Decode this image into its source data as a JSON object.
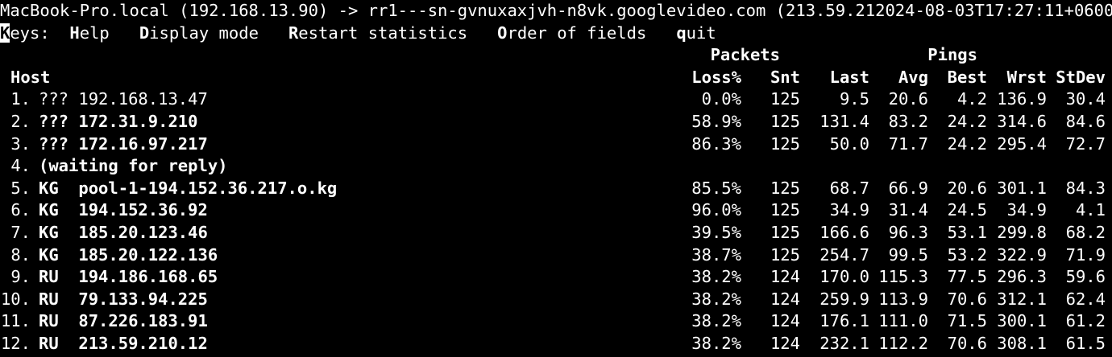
{
  "title_line": "MacBook-Pro.local (192.168.13.90) -> rr1---sn-gvnuxaxjvh-n8vk.googlevideo.com (213.59.212024-08-03T17:27:11+0600",
  "keys": {
    "label_first": "K",
    "label_rest": "eys:",
    "items": [
      {
        "key": "H",
        "rest": "elp"
      },
      {
        "key": "D",
        "rest": "isplay mode"
      },
      {
        "key": "R",
        "rest": "estart statistics"
      },
      {
        "key": "O",
        "rest": "rder of fields"
      },
      {
        "key": "q",
        "rest": "uit"
      }
    ]
  },
  "group_headers": {
    "packets": "Packets",
    "pings": "Pings"
  },
  "columns": {
    "host": "Host",
    "loss": "Loss%",
    "snt": "Snt",
    "last": "Last",
    "avg": "Avg",
    "best": "Best",
    "wrst": "Wrst",
    "stdev": "StDev"
  },
  "rows": [
    {
      "num": "1.",
      "host": "??? 192.168.13.47",
      "loss": "0.0%",
      "snt": "125",
      "last": "9.5",
      "avg": "20.6",
      "best": "4.2",
      "wrst": "136.9",
      "stdev": "30.4"
    },
    {
      "num": "2.",
      "host": "??? 172.31.9.210",
      "loss": "58.9%",
      "snt": "125",
      "last": "131.4",
      "avg": "83.2",
      "best": "24.2",
      "wrst": "314.6",
      "stdev": "84.6"
    },
    {
      "num": "3.",
      "host": "??? 172.16.97.217",
      "loss": "86.3%",
      "snt": "125",
      "last": "50.0",
      "avg": "71.7",
      "best": "24.2",
      "wrst": "295.4",
      "stdev": "72.7"
    },
    {
      "num": "4.",
      "host": "(waiting for reply)",
      "loss": "",
      "snt": "",
      "last": "",
      "avg": "",
      "best": "",
      "wrst": "",
      "stdev": ""
    },
    {
      "num": "5.",
      "host": "KG  pool-1-194.152.36.217.o.kg",
      "loss": "85.5%",
      "snt": "125",
      "last": "68.7",
      "avg": "66.9",
      "best": "20.6",
      "wrst": "301.1",
      "stdev": "84.3"
    },
    {
      "num": "6.",
      "host": "KG  194.152.36.92",
      "loss": "96.0%",
      "snt": "125",
      "last": "34.9",
      "avg": "31.4",
      "best": "24.5",
      "wrst": "34.9",
      "stdev": "4.1"
    },
    {
      "num": "7.",
      "host": "KG  185.20.123.46",
      "loss": "39.5%",
      "snt": "125",
      "last": "166.6",
      "avg": "96.3",
      "best": "53.1",
      "wrst": "299.8",
      "stdev": "68.2"
    },
    {
      "num": "8.",
      "host": "KG  185.20.122.136",
      "loss": "38.7%",
      "snt": "125",
      "last": "254.7",
      "avg": "99.5",
      "best": "53.2",
      "wrst": "322.9",
      "stdev": "71.9"
    },
    {
      "num": "9.",
      "host": "RU  194.186.168.65",
      "loss": "38.2%",
      "snt": "124",
      "last": "170.0",
      "avg": "115.3",
      "best": "77.5",
      "wrst": "296.3",
      "stdev": "59.6"
    },
    {
      "num": "10.",
      "host": "RU  79.133.94.225",
      "loss": "38.2%",
      "snt": "124",
      "last": "259.9",
      "avg": "113.9",
      "best": "70.6",
      "wrst": "312.1",
      "stdev": "62.4"
    },
    {
      "num": "11.",
      "host": "RU  87.226.183.91",
      "loss": "38.2%",
      "snt": "124",
      "last": "176.1",
      "avg": "111.0",
      "best": "71.5",
      "wrst": "300.1",
      "stdev": "61.2"
    },
    {
      "num": "12.",
      "host": "RU  213.59.210.12",
      "loss": "38.2%",
      "snt": "124",
      "last": "232.1",
      "avg": "112.2",
      "best": "70.6",
      "wrst": "308.1",
      "stdev": "61.5"
    }
  ]
}
